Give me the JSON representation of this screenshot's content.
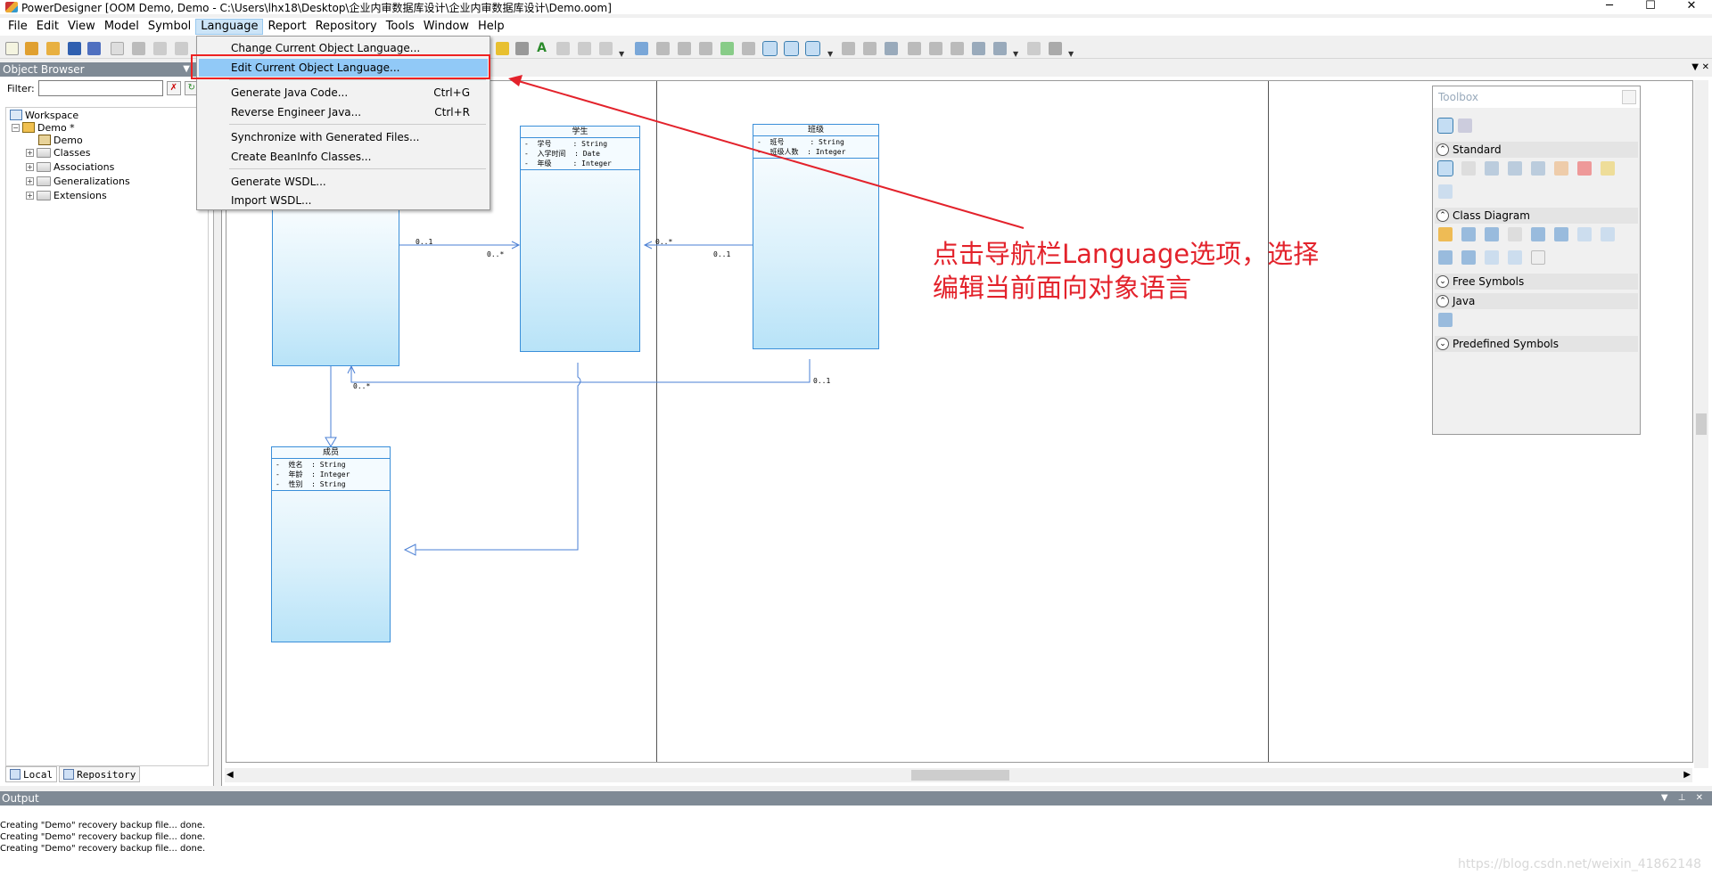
{
  "window": {
    "title": "PowerDesigner [OOM Demo, Demo - C:\\Users\\lhx18\\Desktop\\企业内审数据库设计\\企业内审数据库设计\\Demo.oom]",
    "minimize": "─",
    "maximize": "☐",
    "close": "✕"
  },
  "menubar": {
    "items": [
      {
        "label": "File"
      },
      {
        "label": "Edit"
      },
      {
        "label": "View"
      },
      {
        "label": "Model"
      },
      {
        "label": "Symbol"
      },
      {
        "label": "Language"
      },
      {
        "label": "Report"
      },
      {
        "label": "Repository"
      },
      {
        "label": "Tools"
      },
      {
        "label": "Window"
      },
      {
        "label": "Help"
      }
    ]
  },
  "language_menu": {
    "items": [
      {
        "label": "Change Current Object Language...",
        "shortcut": ""
      },
      {
        "label": "Edit Current Object Language...",
        "shortcut": ""
      },
      {
        "label": "Generate Java Code...",
        "shortcut": "Ctrl+G"
      },
      {
        "label": "Reverse Engineer Java...",
        "shortcut": "Ctrl+R"
      },
      {
        "label": "Synchronize with Generated Files...",
        "shortcut": ""
      },
      {
        "label": "Create BeanInfo Classes...",
        "shortcut": ""
      },
      {
        "label": "Generate WSDL...",
        "shortcut": ""
      },
      {
        "label": "Import WSDL...",
        "shortcut": ""
      }
    ],
    "highlighted": "Edit Current Object Language..."
  },
  "object_browser": {
    "title": "Object Browser",
    "filter_label": "Filter:",
    "filter_value": "",
    "tree": {
      "workspace": "Workspace",
      "model": "Demo *",
      "diagram": "Demo",
      "folders": [
        "Classes",
        "Associations",
        "Generalizations",
        "Extensions"
      ]
    },
    "tabs": [
      {
        "label": "Local"
      },
      {
        "label": "Repository"
      }
    ]
  },
  "diagram": {
    "classes": [
      {
        "name": "学生",
        "attrs": "-  学号     : String\n-  入学时间  : Date\n-  年级     : Integer"
      },
      {
        "name": "班级",
        "attrs": "-  班号      : String\n-  班级人数  : Integer"
      },
      {
        "name": "成员",
        "attrs": "-  姓名  : String\n-  年龄  : Integer\n-  性别  : String"
      }
    ],
    "multiplicities": [
      "0..1",
      "0..*",
      "0..*",
      "0..1",
      "0..*",
      "0..1"
    ]
  },
  "toolbox": {
    "title": "Toolbox",
    "sections": [
      {
        "label": "Standard",
        "state": "collapse"
      },
      {
        "label": "Class Diagram",
        "state": "collapse"
      },
      {
        "label": "Free Symbols",
        "state": "expand"
      },
      {
        "label": "Java",
        "state": "collapse"
      },
      {
        "label": "Predefined Symbols",
        "state": "expand"
      }
    ]
  },
  "annotation": {
    "line1": "点击导航栏Language选项，选择",
    "line2": "编辑当前面向对象语言",
    "color": "#e3222b"
  },
  "output": {
    "title": "Output",
    "lines": [
      "Creating \"Demo\" recovery backup file... done.",
      "Creating \"Demo\" recovery backup file... done.",
      "Creating \"Demo\" recovery backup file... done."
    ],
    "watermark": "https://blog.csdn.net/weixin_41862148"
  },
  "colors": {
    "class_border": "#3a8fd9",
    "link": "#4a7fd4",
    "highlight": "#91c9f7",
    "annotation_red": "#e3222b"
  }
}
